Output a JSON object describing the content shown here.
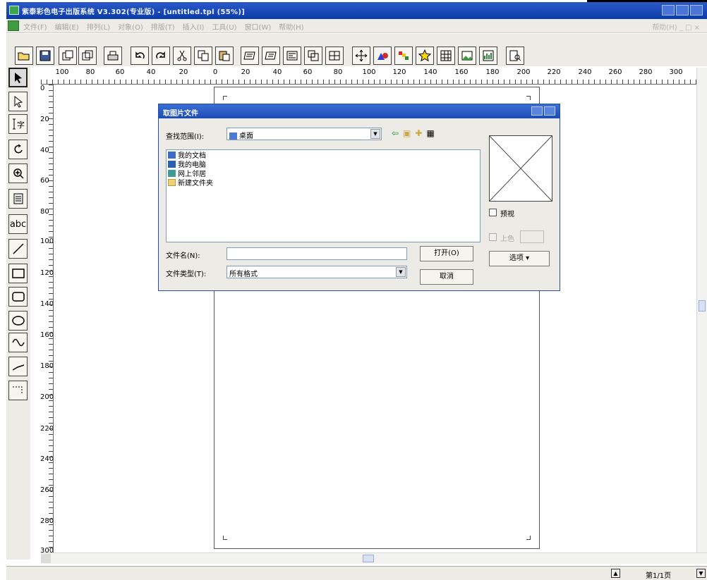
{
  "titlebar": {
    "title": "紫泰彩色电子出版系统 V3.302(专业版) - [untitled.tpl (55%)]"
  },
  "menubar": {
    "items": [
      "文件(F)",
      "编辑(E)",
      "排列(L)",
      "对象(O)",
      "排版(T)",
      "插入(I)",
      "工具(U)",
      "窗口(W)",
      "帮助(H)"
    ],
    "right_text": "帮助(H)  _  □  ×"
  },
  "hruler": {
    "labels": [
      "100",
      "80",
      "60",
      "40",
      "20",
      "0",
      "20",
      "40",
      "60",
      "80",
      "100",
      "120",
      "140",
      "160",
      "180",
      "200",
      "220",
      "240",
      "260",
      "280",
      "300"
    ]
  },
  "vruler": {
    "labels": [
      "0",
      "20",
      "40",
      "60",
      "80",
      "100",
      "120",
      "140",
      "160",
      "180",
      "200",
      "220",
      "240",
      "260",
      "280",
      "300"
    ]
  },
  "dialog": {
    "title": "取图片文件",
    "look_in_label": "查找范围(I):",
    "look_in_value": "桌面",
    "files": [
      {
        "name": "我的文档",
        "icon": "documents-icon"
      },
      {
        "name": "我的电脑",
        "icon": "computer-icon"
      },
      {
        "name": "网上邻居",
        "icon": "network-icon"
      },
      {
        "name": "新建文件夹",
        "icon": "folder-icon"
      }
    ],
    "filename_label": "文件名(N):",
    "filename_value": "",
    "filetype_label": "文件类型(T):",
    "filetype_value": "所有格式",
    "open_button": "打开(O)",
    "cancel_button": "取消",
    "preview_label": "预视",
    "color_label": "上色",
    "options_button": "选项 ▾"
  },
  "statusbar": {
    "page_label": "第1/1页"
  },
  "colors": {
    "titlebar": "#0a3ca8",
    "chrome": "#ecebe5"
  }
}
